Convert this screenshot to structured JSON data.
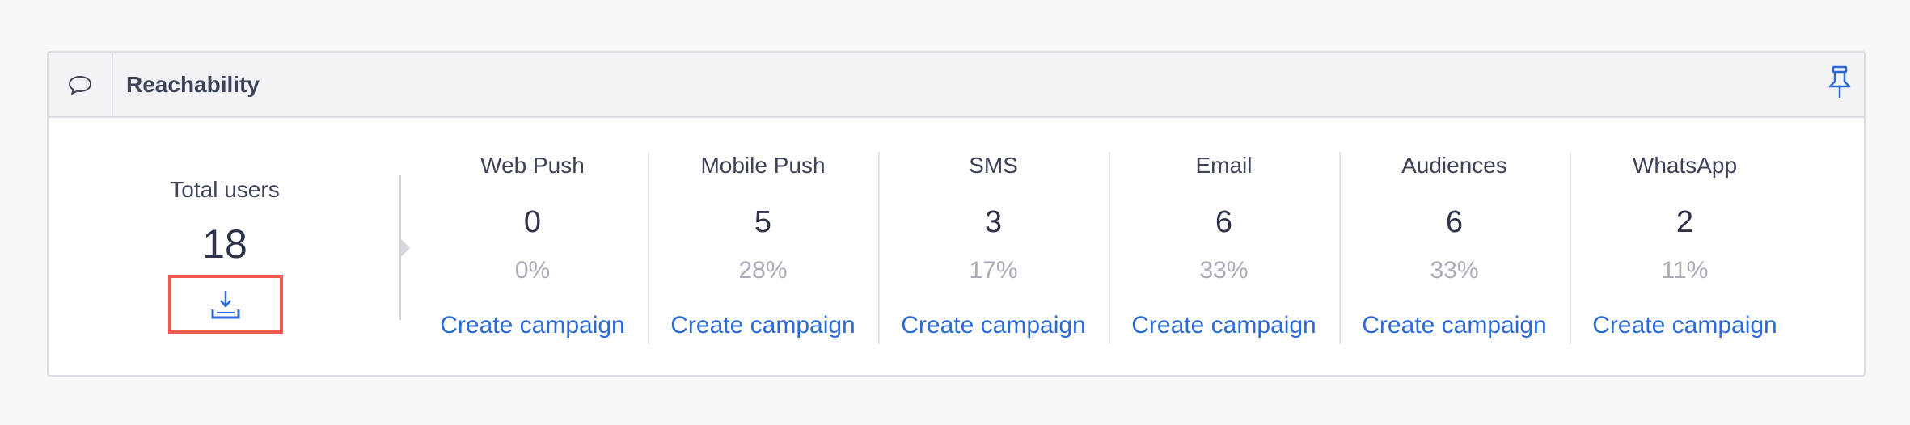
{
  "card": {
    "title": "Reachability",
    "header_icon": "speech-bubble-icon",
    "pin_icon": "pin-icon"
  },
  "total": {
    "label": "Total users",
    "value": "18",
    "download_icon": "download-icon"
  },
  "channels": [
    {
      "name": "Web Push",
      "count": "0",
      "percent": "0%",
      "link": "Create campaign"
    },
    {
      "name": "Mobile Push",
      "count": "5",
      "percent": "28%",
      "link": "Create campaign"
    },
    {
      "name": "SMS",
      "count": "3",
      "percent": "17%",
      "link": "Create campaign"
    },
    {
      "name": "Email",
      "count": "6",
      "percent": "33%",
      "link": "Create campaign"
    },
    {
      "name": "Audiences",
      "count": "6",
      "percent": "33%",
      "link": "Create campaign"
    },
    {
      "name": "WhatsApp",
      "count": "2",
      "percent": "11%",
      "link": "Create campaign"
    }
  ],
  "colors": {
    "accent": "#2b6ad6",
    "highlight_border": "#ee5a4f",
    "text_dark": "#3d4257",
    "text_muted": "#a9abb6"
  }
}
